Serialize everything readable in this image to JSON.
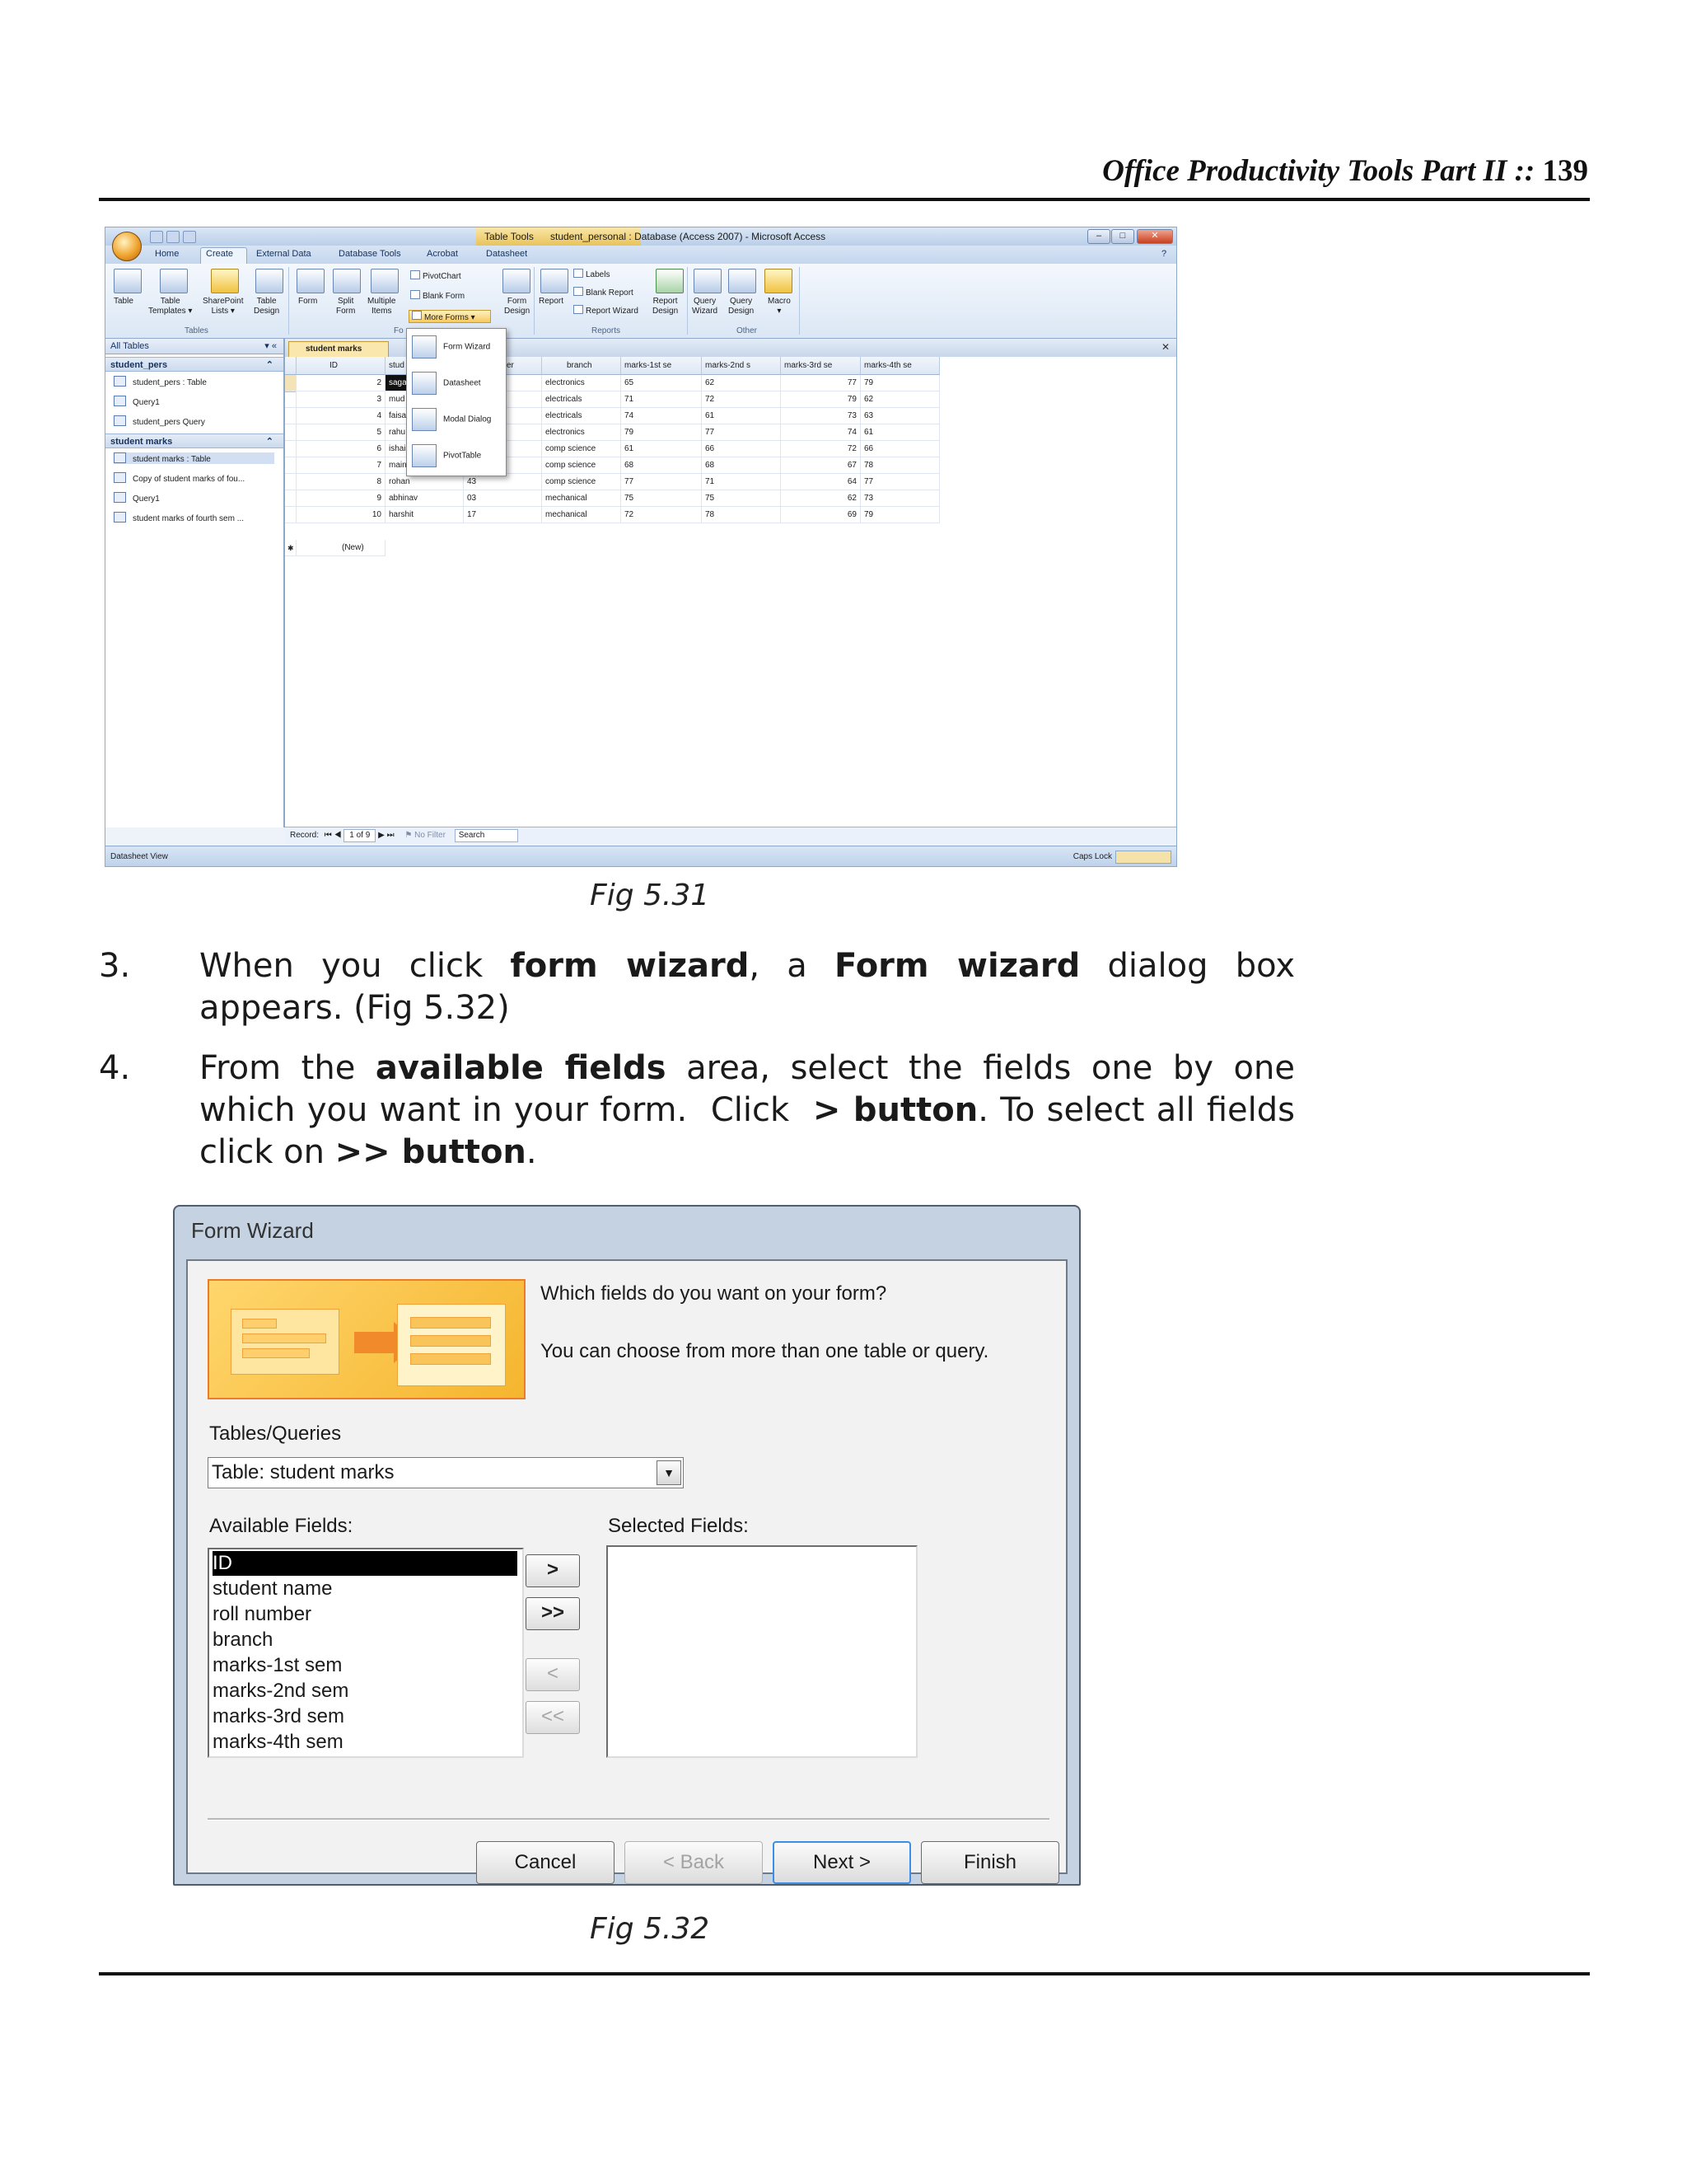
{
  "header": {
    "title": "Office Productivity Tools Part II",
    "separator": "::",
    "page_number": "139"
  },
  "fig531": {
    "caption": "Fig 5.31",
    "window_title": "student_personal : Database (Access 2007) - Microsoft Access",
    "context_tab": "Table Tools",
    "ribbon_tabs": [
      "Home",
      "Create",
      "External Data",
      "Database Tools",
      "Acrobat",
      "Datasheet"
    ],
    "ribbon": {
      "tables": {
        "group": "Tables",
        "buttons": [
          "Table",
          "Table\nTemplates ▾",
          "SharePoint\nLists ▾",
          "Table\nDesign"
        ]
      },
      "forms": {
        "group": "Fo",
        "buttons": [
          "Form",
          "Split\nForm",
          "Multiple\nItems",
          "Form\nDesign"
        ],
        "small": [
          "PivotChart",
          "Blank Form",
          "More Forms ▾"
        ]
      },
      "reports": {
        "group": "Reports",
        "buttons": [
          "Report",
          "Report\nDesign"
        ],
        "small": [
          "Labels",
          "Blank Report",
          "Report Wizard"
        ]
      },
      "other": {
        "group": "Other",
        "buttons": [
          "Query\nWizard",
          "Query\nDesign",
          "Macro\n▾"
        ]
      }
    },
    "dropdown": [
      "Form Wizard",
      "Datasheet",
      "Modal Dialog",
      "PivotTable"
    ],
    "nav": {
      "header": "All Tables",
      "groups": [
        {
          "name": "student_pers",
          "items": [
            "student_pers : Table",
            "Query1",
            "student_pers Query"
          ]
        },
        {
          "name": "student marks",
          "items": [
            "student marks : Table",
            "Copy of student marks of fou...",
            "Query1",
            "student marks of fourth sem ..."
          ]
        }
      ]
    },
    "doc_tab": "student marks",
    "grid": {
      "columns": [
        "ID",
        "stud",
        "er",
        "branch",
        "marks-1st se",
        "marks-2nd s",
        "marks-3rd se",
        "marks-4th se"
      ],
      "rows": [
        [
          "2",
          "saga",
          "",
          "electronics",
          "65",
          "62",
          "77",
          "79"
        ],
        [
          "3",
          "mud",
          "",
          "electricals",
          "71",
          "72",
          "79",
          "62"
        ],
        [
          "4",
          "faisa",
          "",
          "electricals",
          "74",
          "61",
          "73",
          "63"
        ],
        [
          "5",
          "rahu",
          "",
          "electronics",
          "79",
          "77",
          "74",
          "61"
        ],
        [
          "6",
          "ishai",
          "",
          "comp science",
          "61",
          "66",
          "72",
          "66"
        ],
        [
          "7",
          "main",
          "",
          "comp science",
          "68",
          "68",
          "67",
          "78"
        ],
        [
          "8",
          "rohan",
          "43",
          "comp science",
          "77",
          "71",
          "64",
          "77"
        ],
        [
          "9",
          "abhinav",
          "03",
          "mechanical",
          "75",
          "75",
          "62",
          "73"
        ],
        [
          "10",
          "harshit",
          "17",
          "mechanical",
          "72",
          "78",
          "69",
          "79"
        ]
      ],
      "new_row": "(New)"
    },
    "record_nav": {
      "label": "Record:",
      "position": "1 of 9",
      "filter": "No Filter",
      "search": "Search"
    },
    "status": {
      "left": "Datasheet View",
      "right": "Caps Lock"
    }
  },
  "steps": [
    {
      "num": "3."
    },
    {
      "num": "4."
    }
  ],
  "fig532": {
    "caption": "Fig 5.32",
    "title": "Form Wizard",
    "question": "Which fields do you want on your form?",
    "hint": "You can choose from more than one table or query.",
    "tables_label": "Tables/Queries",
    "tables_value": "Table: student marks",
    "available_label": "Available Fields:",
    "selected_label": "Selected Fields:",
    "available_fields": [
      "ID",
      "student name",
      "roll number",
      "branch",
      "marks-1st sem",
      "marks-2nd sem",
      "marks-3rd sem",
      "marks-4th sem"
    ],
    "move_buttons": [
      ">",
      ">>",
      "<",
      "<<"
    ],
    "buttons": [
      "Cancel",
      "< Back",
      "Next >",
      "Finish"
    ]
  }
}
